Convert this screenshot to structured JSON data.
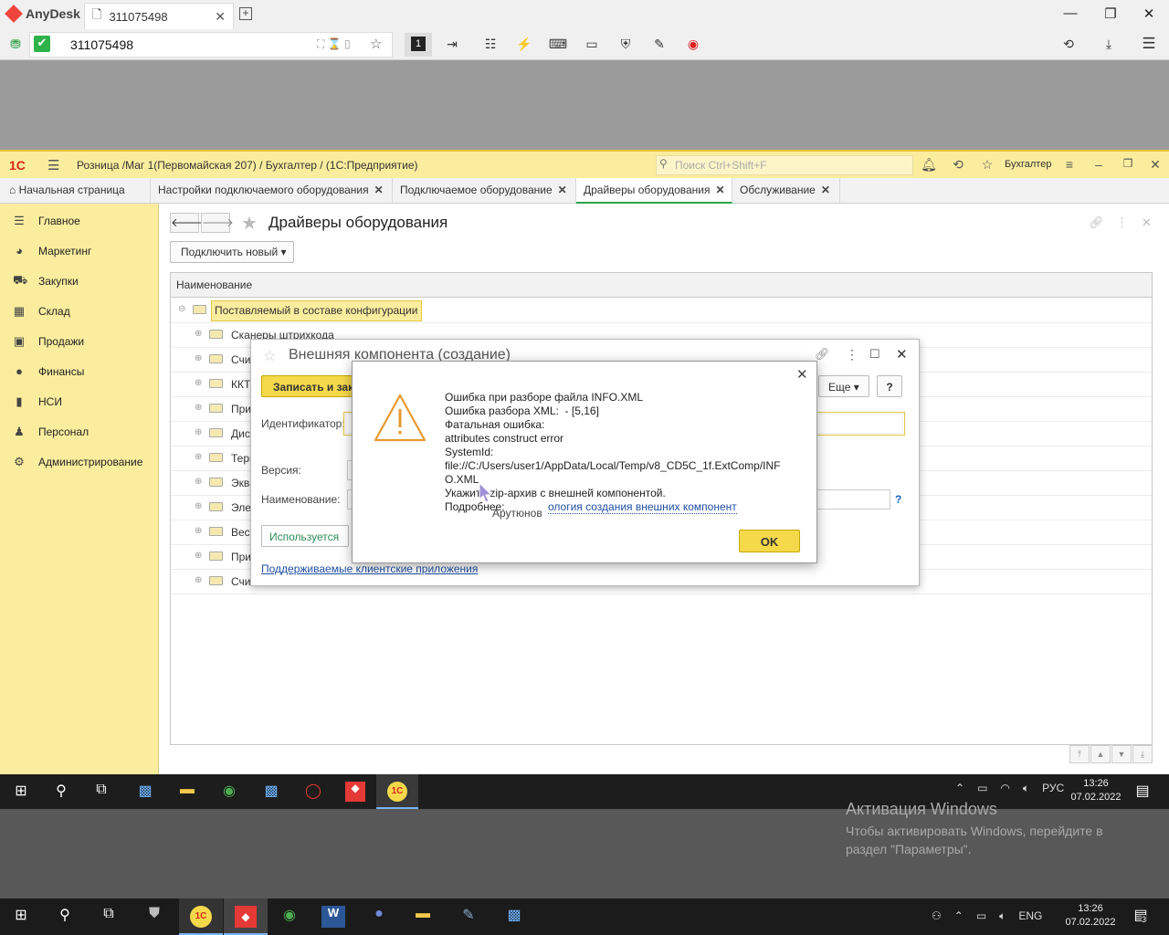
{
  "anydesk": {
    "app_name": "AnyDesk",
    "tab_label": "311075498",
    "address": "311075498",
    "monitor_badge": "1"
  },
  "onec": {
    "logo": "1С",
    "title": "Розница /Маг 1(Первомайская 207) / Бухгалтер /  (1С:Предприятие)",
    "search_placeholder": "Поиск Ctrl+Shift+F",
    "user": "Бухгалтер",
    "tabs": [
      {
        "label": "Начальная страница"
      },
      {
        "label": "Настройки подключаемого оборудования"
      },
      {
        "label": "Подключаемое оборудование"
      },
      {
        "label": "Драйверы оборудования"
      },
      {
        "label": "Обслуживание"
      }
    ],
    "sidebar": [
      {
        "label": "Главное",
        "icon": "list-icon"
      },
      {
        "label": "Маркетинг",
        "icon": "pie-icon"
      },
      {
        "label": "Закупки",
        "icon": "cart-icon"
      },
      {
        "label": "Склад",
        "icon": "grid-icon"
      },
      {
        "label": "Продажи",
        "icon": "bag-icon"
      },
      {
        "label": "Финансы",
        "icon": "coin-icon"
      },
      {
        "label": "НСИ",
        "icon": "book-icon"
      },
      {
        "label": "Персонал",
        "icon": "person-icon"
      },
      {
        "label": "Администрирование",
        "icon": "gear-icon"
      }
    ],
    "page_title": "Драйверы оборудования",
    "connect_new": "Подключить новый",
    "column_header": "Наименование",
    "rows": [
      "Поставляемый в составе конфигурации",
      "Сканеры штрихкода",
      "Считыватели",
      "ККТ",
      "Принтеры",
      "Дисплеи",
      "Терминалы",
      "Эквайринговые",
      "Электронные",
      "Весы",
      "Принтеры",
      "Считыватели RFID"
    ]
  },
  "ext_dialog": {
    "title": "Внешняя компонента (создание)",
    "save_button": "Записать и закрыть",
    "more_button": "Еще",
    "help_button": "?",
    "label_id": "Идентификатор:",
    "label_version": "Версия:",
    "label_name": "Наименование:",
    "used_button": "Используется",
    "supported_link": "Поддерживаемые клиентские приложения",
    "name_help": "?"
  },
  "error_dialog": {
    "message": "Ошибка при разборе файла INFO.XML\nОшибка разбора XML:  - [5,16]\nФатальная ошибка:\nattributes construct error\nSystemId:\nfile://C:/Users/user1/AppData/Local/Temp/v8_CD5C_1f.ExtComp/INFO.XML\nУкажите zip-архив с внешней компонентой.\nПодробнее:",
    "partial_author": "Арутюнов",
    "link": "ология создания внешних компонент",
    "ok": "OK"
  },
  "inner_taskbar": {
    "lang": "РУС",
    "time": "13:26",
    "date": "07.02.2022",
    "activation_title": "Активация Windows",
    "activation_text": "Чтобы активировать Windows, перейдите в раздел \"Параметры\"."
  },
  "outer_taskbar": {
    "lang": "ENG",
    "time": "13:26",
    "date": "07.02.2022",
    "notif_count": "3"
  }
}
